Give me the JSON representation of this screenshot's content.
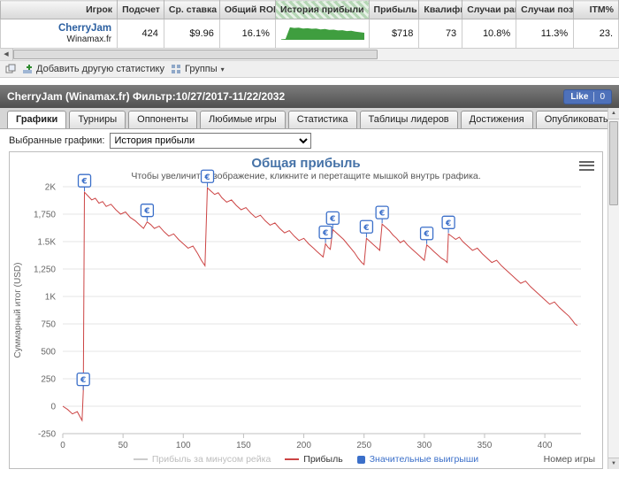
{
  "table": {
    "headers": [
      "Игрок",
      "Подсчет",
      "Ср. ставка",
      "Общий ROI",
      "История прибыли",
      "Прибыль",
      "Квалифи",
      "Случаи ран",
      "Случаи поздн",
      "ITM%"
    ],
    "row": {
      "player": "CherryJam",
      "site": "Winamax.fr",
      "count": "424",
      "avg_stake": "$9.96",
      "total_roi": "16.1%",
      "profit": "$718",
      "qualified": "73",
      "early_cases": "10.8%",
      "late_cases": "11.3%",
      "itm": "23.",
      "sparkline_values": [
        4,
        6,
        88,
        84,
        86,
        80,
        82,
        78,
        80,
        74,
        76,
        70,
        72,
        66,
        68,
        62,
        64,
        58,
        54,
        50
      ],
      "sparkline_color": "#3f9e3f"
    }
  },
  "toolbar": {
    "add_stat_label": "Добавить другую статистику",
    "groups_label": "Группы"
  },
  "section_header": {
    "title": "CherryJam (Winamax.fr) Фильтр:10/27/2017-11/22/2032",
    "like_label": "Like",
    "like_count": "0"
  },
  "tabs": [
    {
      "label": "Графики",
      "active": true
    },
    {
      "label": "Турниры",
      "active": false
    },
    {
      "label": "Оппоненты",
      "active": false
    },
    {
      "label": "Любимые игры",
      "active": false
    },
    {
      "label": "Статистика",
      "active": false
    },
    {
      "label": "Таблицы лидеров",
      "active": false
    },
    {
      "label": "Достижения",
      "active": false
    },
    {
      "label": "Опубликовать",
      "active": false
    }
  ],
  "graph_picker": {
    "label": "Выбранные графики:",
    "selected": "История прибыли"
  },
  "chart_data": {
    "type": "line",
    "title": "Общая прибыль",
    "subtitle": "Чтобы увеличить изображение, кликните и перетащите мышкой внутрь графика.",
    "xlabel": "Номер игры",
    "ylabel": "Суммарный итог (USD)",
    "xlim": [
      0,
      430
    ],
    "ylim": [
      -250,
      2000
    ],
    "xticks": [
      0,
      50,
      100,
      150,
      200,
      250,
      300,
      350,
      400
    ],
    "yticks": [
      {
        "v": 2000,
        "label": "2K"
      },
      {
        "v": 1750,
        "label": "1,750"
      },
      {
        "v": 1500,
        "label": "1.5K"
      },
      {
        "v": 1250,
        "label": "1,250"
      },
      {
        "v": 1000,
        "label": "1K"
      },
      {
        "v": 750,
        "label": "750"
      },
      {
        "v": 500,
        "label": "500"
      },
      {
        "v": 250,
        "label": "250"
      },
      {
        "v": 0,
        "label": "0"
      },
      {
        "v": -250,
        "label": "-250"
      }
    ],
    "legend": [
      {
        "label": "Прибыль за минусом рейка",
        "color": "#cccccc",
        "type": "line",
        "disabled": true
      },
      {
        "label": "Прибыль",
        "color": "#cc4444",
        "type": "line",
        "disabled": false
      },
      {
        "label": "Значительные выигрыши",
        "color": "#3b6fc9",
        "type": "marker",
        "disabled": false,
        "text_color": "#3b6fc9"
      }
    ],
    "series": [
      {
        "name": "Прибыль",
        "color": "#cc4444",
        "points": [
          [
            0,
            0
          ],
          [
            4,
            -30
          ],
          [
            8,
            -70
          ],
          [
            12,
            -50
          ],
          [
            15,
            -110
          ],
          [
            16,
            -130
          ],
          [
            17,
            140
          ],
          [
            18,
            1950
          ],
          [
            21,
            1915
          ],
          [
            24,
            1880
          ],
          [
            27,
            1895
          ],
          [
            30,
            1850
          ],
          [
            33,
            1865
          ],
          [
            36,
            1820
          ],
          [
            40,
            1840
          ],
          [
            44,
            1790
          ],
          [
            48,
            1750
          ],
          [
            52,
            1770
          ],
          [
            56,
            1720
          ],
          [
            60,
            1690
          ],
          [
            64,
            1650
          ],
          [
            67,
            1620
          ],
          [
            70,
            1680
          ],
          [
            73,
            1655
          ],
          [
            76,
            1620
          ],
          [
            80,
            1640
          ],
          [
            84,
            1590
          ],
          [
            88,
            1550
          ],
          [
            92,
            1570
          ],
          [
            96,
            1520
          ],
          [
            100,
            1480
          ],
          [
            104,
            1440
          ],
          [
            108,
            1460
          ],
          [
            112,
            1390
          ],
          [
            115,
            1330
          ],
          [
            118,
            1280
          ],
          [
            120,
            1990
          ],
          [
            123,
            1960
          ],
          [
            126,
            1930
          ],
          [
            129,
            1945
          ],
          [
            132,
            1900
          ],
          [
            136,
            1860
          ],
          [
            140,
            1880
          ],
          [
            144,
            1830
          ],
          [
            148,
            1790
          ],
          [
            152,
            1810
          ],
          [
            156,
            1760
          ],
          [
            160,
            1720
          ],
          [
            164,
            1740
          ],
          [
            168,
            1690
          ],
          [
            172,
            1650
          ],
          [
            176,
            1670
          ],
          [
            180,
            1620
          ],
          [
            184,
            1580
          ],
          [
            188,
            1600
          ],
          [
            192,
            1550
          ],
          [
            196,
            1510
          ],
          [
            200,
            1530
          ],
          [
            204,
            1480
          ],
          [
            208,
            1440
          ],
          [
            211,
            1410
          ],
          [
            214,
            1380
          ],
          [
            216,
            1360
          ],
          [
            218,
            1480
          ],
          [
            220,
            1450
          ],
          [
            222,
            1430
          ],
          [
            224,
            1610
          ],
          [
            227,
            1580
          ],
          [
            230,
            1550
          ],
          [
            233,
            1520
          ],
          [
            236,
            1480
          ],
          [
            239,
            1440
          ],
          [
            242,
            1400
          ],
          [
            245,
            1350
          ],
          [
            248,
            1310
          ],
          [
            250,
            1290
          ],
          [
            252,
            1530
          ],
          [
            255,
            1500
          ],
          [
            258,
            1470
          ],
          [
            261,
            1440
          ],
          [
            263,
            1420
          ],
          [
            265,
            1660
          ],
          [
            268,
            1630
          ],
          [
            271,
            1600
          ],
          [
            274,
            1560
          ],
          [
            277,
            1530
          ],
          [
            280,
            1490
          ],
          [
            283,
            1510
          ],
          [
            286,
            1470
          ],
          [
            290,
            1430
          ],
          [
            294,
            1390
          ],
          [
            298,
            1350
          ],
          [
            300,
            1330
          ],
          [
            302,
            1470
          ],
          [
            305,
            1440
          ],
          [
            308,
            1410
          ],
          [
            311,
            1380
          ],
          [
            314,
            1350
          ],
          [
            317,
            1330
          ],
          [
            319,
            1310
          ],
          [
            320,
            1570
          ],
          [
            323,
            1545
          ],
          [
            326,
            1520
          ],
          [
            329,
            1540
          ],
          [
            332,
            1500
          ],
          [
            336,
            1460
          ],
          [
            340,
            1420
          ],
          [
            344,
            1440
          ],
          [
            348,
            1390
          ],
          [
            352,
            1350
          ],
          [
            356,
            1310
          ],
          [
            360,
            1330
          ],
          [
            364,
            1280
          ],
          [
            368,
            1240
          ],
          [
            372,
            1200
          ],
          [
            376,
            1160
          ],
          [
            380,
            1120
          ],
          [
            384,
            1140
          ],
          [
            388,
            1090
          ],
          [
            392,
            1050
          ],
          [
            396,
            1010
          ],
          [
            400,
            970
          ],
          [
            404,
            930
          ],
          [
            408,
            950
          ],
          [
            412,
            900
          ],
          [
            416,
            860
          ],
          [
            420,
            820
          ],
          [
            423,
            780
          ],
          [
            425,
            750
          ],
          [
            427,
            735
          ]
        ]
      }
    ],
    "significant_wins": [
      [
        17,
        140
      ],
      [
        18,
        1950
      ],
      [
        70,
        1680
      ],
      [
        120,
        1990
      ],
      [
        218,
        1480
      ],
      [
        224,
        1610
      ],
      [
        252,
        1530
      ],
      [
        265,
        1660
      ],
      [
        302,
        1470
      ],
      [
        320,
        1570
      ]
    ]
  }
}
